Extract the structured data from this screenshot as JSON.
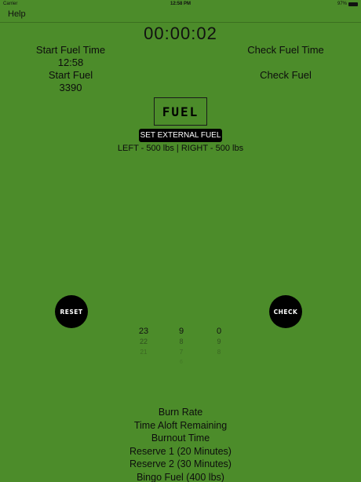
{
  "status_bar": {
    "carrier": "Carrier",
    "time": "12:58 PM",
    "battery": "97%"
  },
  "nav": {
    "help_label": "Help"
  },
  "timer": "00:00:02",
  "start": {
    "time_label": "Start Fuel Time",
    "time_value": "12:58",
    "fuel_label": "Start Fuel",
    "fuel_value": "3390"
  },
  "check": {
    "time_label": "Check Fuel Time",
    "fuel_label": "Check Fuel"
  },
  "logo_text": "FUEL",
  "external": {
    "button_label": "SET EXTERNAL FUEL",
    "info": "LEFT - 500 lbs | RIGHT - 500 lbs"
  },
  "buttons": {
    "reset": "RESET",
    "check": "CHECK"
  },
  "picker": {
    "col1": [
      "23",
      "22",
      "21",
      ""
    ],
    "col2": [
      "9",
      "8",
      "7",
      "6"
    ],
    "col3": [
      "0",
      "9",
      "8",
      ""
    ]
  },
  "results": [
    "Burn Rate",
    "Time Aloft Remaining",
    "Burnout Time",
    "Reserve 1 (20 Minutes)",
    "Reserve 2 (30 Minutes)",
    "Bingo Fuel (400 lbs)"
  ]
}
